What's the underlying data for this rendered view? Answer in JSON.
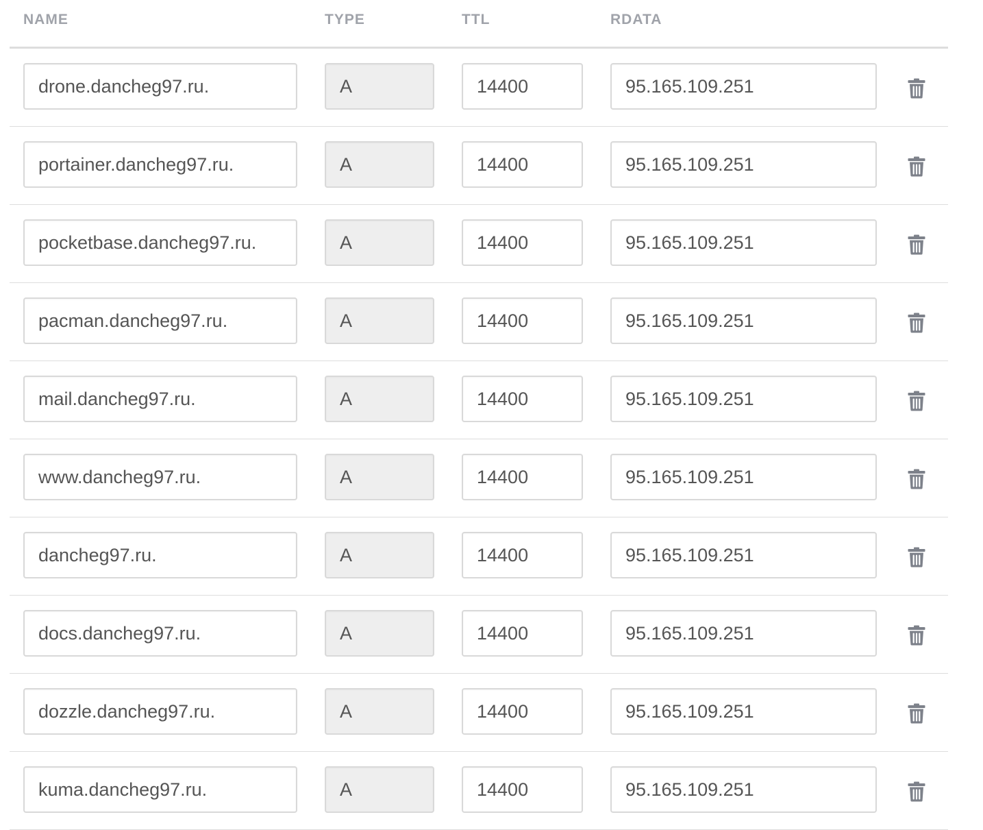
{
  "table": {
    "headers": {
      "name": "NAME",
      "type": "TYPE",
      "ttl": "TTL",
      "rdata": "RDATA"
    },
    "records": [
      {
        "name": "drone.dancheg97.ru.",
        "type": "A",
        "ttl": "14400",
        "rdata": "95.165.109.251"
      },
      {
        "name": "portainer.dancheg97.ru.",
        "type": "A",
        "ttl": "14400",
        "rdata": "95.165.109.251"
      },
      {
        "name": "pocketbase.dancheg97.ru.",
        "type": "A",
        "ttl": "14400",
        "rdata": "95.165.109.251"
      },
      {
        "name": "pacman.dancheg97.ru.",
        "type": "A",
        "ttl": "14400",
        "rdata": "95.165.109.251"
      },
      {
        "name": "mail.dancheg97.ru.",
        "type": "A",
        "ttl": "14400",
        "rdata": "95.165.109.251"
      },
      {
        "name": "www.dancheg97.ru.",
        "type": "A",
        "ttl": "14400",
        "rdata": "95.165.109.251"
      },
      {
        "name": "dancheg97.ru.",
        "type": "A",
        "ttl": "14400",
        "rdata": "95.165.109.251"
      },
      {
        "name": "docs.dancheg97.ru.",
        "type": "A",
        "ttl": "14400",
        "rdata": "95.165.109.251"
      },
      {
        "name": "dozzle.dancheg97.ru.",
        "type": "A",
        "ttl": "14400",
        "rdata": "95.165.109.251"
      },
      {
        "name": "kuma.dancheg97.ru.",
        "type": "A",
        "ttl": "14400",
        "rdata": "95.165.109.251"
      }
    ],
    "delete_icon": "trash-icon",
    "colors": {
      "header_text": "#a0a3aa",
      "field_text": "#555555",
      "field_border": "#d9d9d9",
      "readonly_bg": "#eeeeee",
      "row_divider": "#dddddd",
      "icon": "#7d818a"
    }
  }
}
